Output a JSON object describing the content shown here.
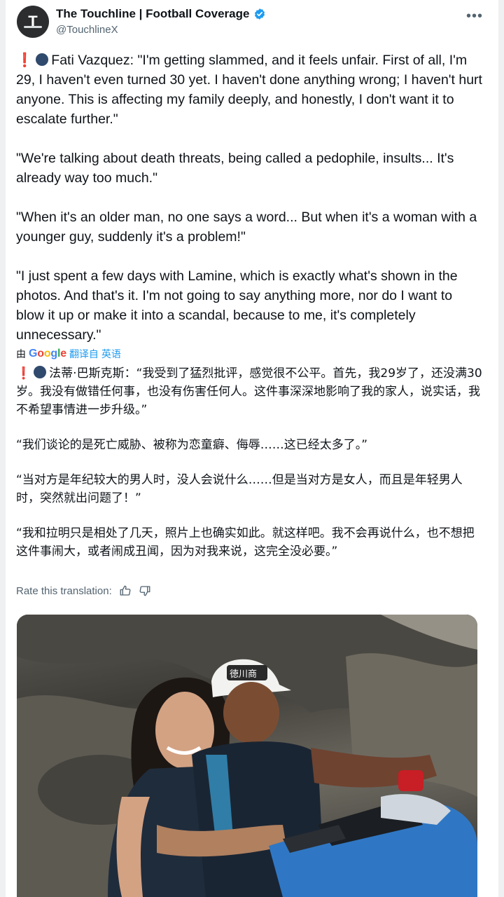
{
  "account": {
    "display_name": "The Touchline | Football Coverage",
    "handle": "@TouchlineX",
    "avatar_letter": "T",
    "verified": true
  },
  "tweet": {
    "paragraphs": [
      "Fati Vazquez: \"I'm getting slammed, and it feels unfair. First of all, I'm 29, I haven't even turned 30 yet. I haven't done anything wrong; I haven't hurt anyone. This is affecting my family deeply, and honestly, I don't want it to escalate further.\"",
      "\"We're talking about death threats, being called a pedophile, insults... It's already way too much.\"",
      "\"When it's an older man, no one says a word... But when it's a woman with a younger guy, suddenly it's a problem!\"",
      "\"I just spent a few days with Lamine, which is exactly what's shown in the photos. And that's it. I'm not going to say anything more, nor do I want to blow it up or make it into a scandal, because to me, it's completely unnecessary.\""
    ]
  },
  "translation_banner": {
    "prefix": "由",
    "provider": "Google",
    "link": "翻译自 英语"
  },
  "translation": {
    "paragraphs": [
      "法蒂·巴斯克斯：“我受到了猛烈批评，感觉很不公平。首先，我29岁了，还没满30岁。我没有做错任何事，也没有伤害任何人。这件事深深地影响了我的家人，说实话，我不希望事情进一步升级。”",
      "“我们谈论的是死亡威胁、被称为恋童癖、侮辱……这已经太多了。”",
      "“当对方是年纪较大的男人时，没人会说什么……但是当对方是女人，而且是年轻男人时，突然就出问题了！”",
      "“我和拉明只是相处了几天，照片上也确实如此。就这样吧。我不会再说什么，也不想把这件事闹大，或者闹成丑闻，因为对我来说，这完全没必要。”"
    ]
  },
  "rate": {
    "label": "Rate this translation:"
  },
  "colors": {
    "link": "#1d9bf0",
    "secondary_text": "#536471",
    "verified": "#1d9bf0",
    "alarm": "#e0241b"
  },
  "icons": [
    "verified-badge-icon",
    "more-dots-icon",
    "exclamation-icon",
    "speaking-head-icon",
    "thumbs-up-icon",
    "thumbs-down-icon"
  ]
}
